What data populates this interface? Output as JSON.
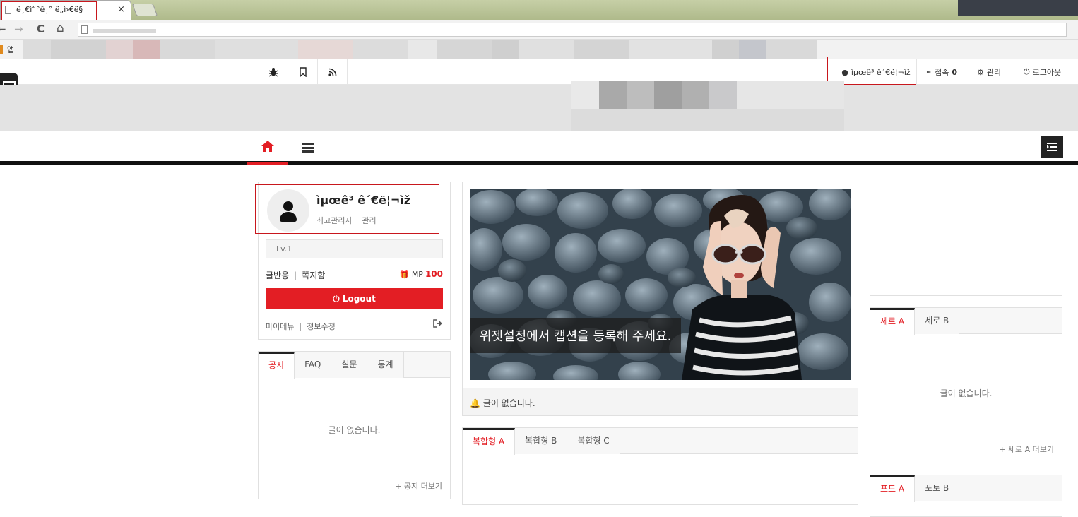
{
  "browser": {
    "tab_title": "ê¸€ì“°ê¸° ë„ì›€ë§",
    "tab_close": "×",
    "nav_back": "←",
    "nav_forward": "→",
    "nav_reload": "C",
    "nav_home": "⌂",
    "bookmarks_apps": "앱"
  },
  "util": {
    "user_label": "ìµœê³ ê´€ë¦¬ìž",
    "connect_label": "접속",
    "connect_count": "0",
    "admin_label": "관리",
    "logout_label": "로그아웃"
  },
  "profile": {
    "name": "ìµœê³ ê´€ë¦¬ìž",
    "role": "최고관리자",
    "role_link": "관리",
    "level": "Lv.1",
    "link_reply": "글반응",
    "link_memo": "쪽지함",
    "mp_label": "MP",
    "mp_value": "100",
    "logout_button": "Logout",
    "my_menu": "마이메뉴",
    "edit_info": "정보수정"
  },
  "notice_widget": {
    "tabs": [
      "공지",
      "FAQ",
      "설문",
      "통계"
    ],
    "empty": "글이 없습니다.",
    "more": "+ 공지 더보기"
  },
  "slider": {
    "caption": "위젯설정에서 캡션을 등록해 주세요.",
    "notice": "글이 없습니다."
  },
  "complex_widget": {
    "tabs": [
      "복합형 A",
      "복합형 B",
      "복합형 C"
    ]
  },
  "vertical_widget": {
    "tabs": [
      "세로 A",
      "세로 B"
    ],
    "empty": "글이 없습니다.",
    "more": "+ 세로 A 더보기"
  },
  "photo_widget": {
    "tabs": [
      "포토 A",
      "포토 B"
    ]
  },
  "colors": {
    "accent": "#e31e24",
    "annotation": "#c8171d",
    "nav_border": "#111111"
  }
}
